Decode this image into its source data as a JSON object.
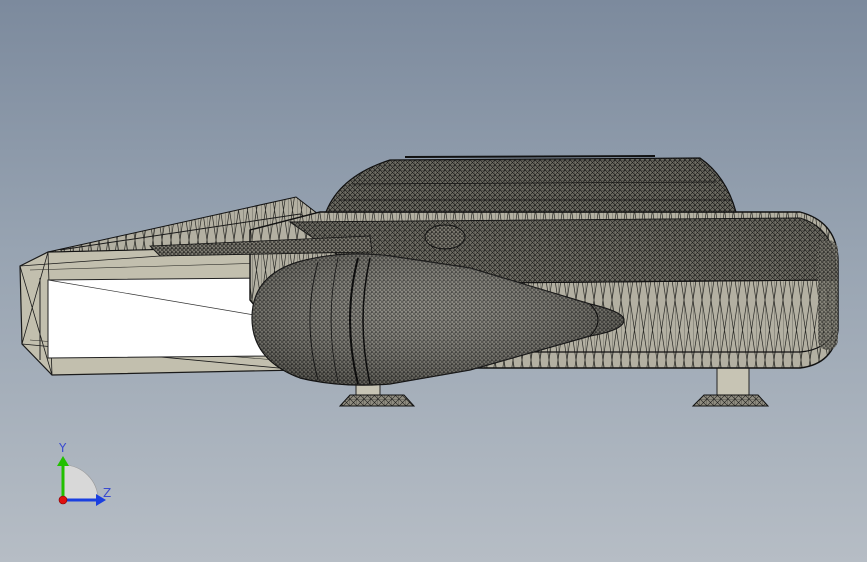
{
  "viewport": {
    "background_top": "#7c8a9d",
    "background_bottom": "#b6bdc5",
    "render_mode": "shaded-with-edges"
  },
  "model": {
    "name": "spaceship-mesh",
    "colors": {
      "hull_fill": "#a8a596",
      "hull_dark": "#45443e",
      "window_fill": "#ffffff",
      "edge": "#1a1a1a"
    }
  },
  "triad": {
    "y_label": "Y",
    "z_label": "Z",
    "colors": {
      "y": "#22c000",
      "z": "#1a3fe0",
      "x": "#e01010"
    }
  }
}
